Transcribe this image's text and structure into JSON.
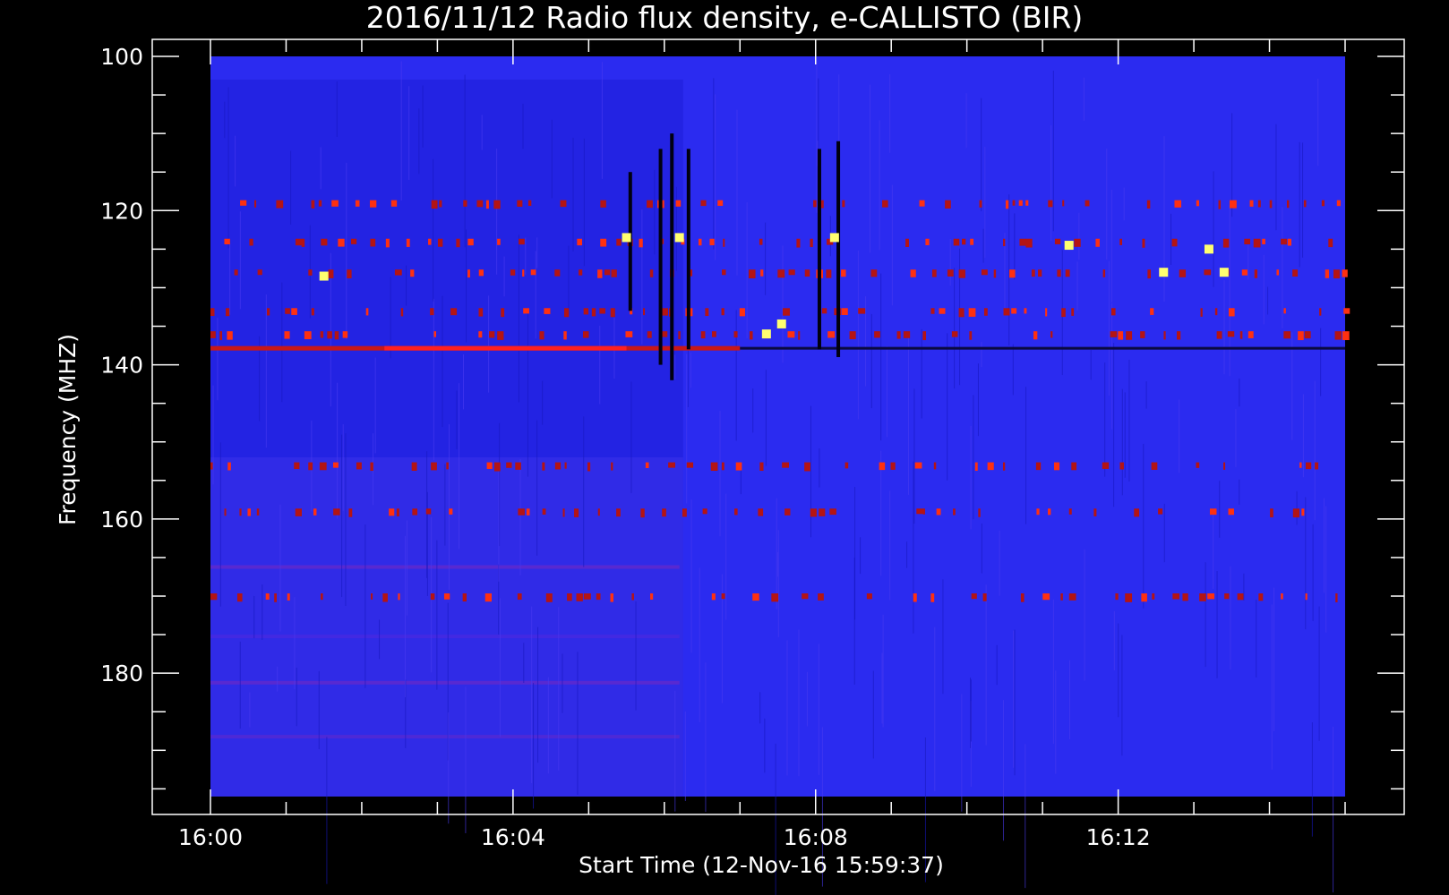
{
  "chart_data": {
    "type": "heatmap",
    "title": "2016/11/12  Radio flux density, e-CALLISTO (BIR)",
    "xlabel": "Start Time (12-Nov-16 15:59:37)",
    "ylabel": "Frequency (MHZ)",
    "x_ticks": [
      {
        "label": "16:00",
        "minutes": 0
      },
      {
        "label": "16:04",
        "minutes": 4
      },
      {
        "label": "16:08",
        "minutes": 8
      },
      {
        "label": "16:12",
        "minutes": 12
      }
    ],
    "y_ticks": [
      100,
      120,
      140,
      160,
      180
    ],
    "xlim_minutes_after_1600": [
      0,
      15
    ],
    "ylim_mhz": [
      100,
      196
    ],
    "y_axis_inverted": true,
    "colormap": [
      "#000000",
      "#1a1acc",
      "#2e2eff",
      "#b41414",
      "#ff3010",
      "#ffff70"
    ],
    "background_color": "#2b2bf0",
    "features": {
      "persistent_bands_mhz": [
        119,
        124,
        128,
        133,
        136,
        153,
        159,
        170
      ],
      "strong_band_mhz": 137.8,
      "strong_band_end_minute": 7.0,
      "dark_spikes": [
        {
          "time_min": 5.55,
          "f_top": 115,
          "f_bottom": 133
        },
        {
          "time_min": 5.95,
          "f_top": 112,
          "f_bottom": 140
        },
        {
          "time_min": 6.1,
          "f_top": 110,
          "f_bottom": 142
        },
        {
          "time_min": 6.32,
          "f_top": 112,
          "f_bottom": 138
        },
        {
          "time_min": 8.05,
          "f_top": 112,
          "f_bottom": 138
        },
        {
          "time_min": 8.3,
          "f_top": 111,
          "f_bottom": 139
        }
      ],
      "bright_spots": [
        {
          "time_min": 5.5,
          "freq": 123.5
        },
        {
          "time_min": 6.2,
          "freq": 123.5
        },
        {
          "time_min": 8.25,
          "freq": 123.5
        },
        {
          "time_min": 7.35,
          "freq": 136
        },
        {
          "time_min": 7.55,
          "freq": 134.7
        },
        {
          "time_min": 12.6,
          "freq": 128
        },
        {
          "time_min": 13.4,
          "freq": 128
        },
        {
          "time_min": 13.2,
          "freq": 125
        },
        {
          "time_min": 11.35,
          "freq": 124.5
        },
        {
          "time_min": 1.5,
          "freq": 128.5
        }
      ]
    }
  }
}
